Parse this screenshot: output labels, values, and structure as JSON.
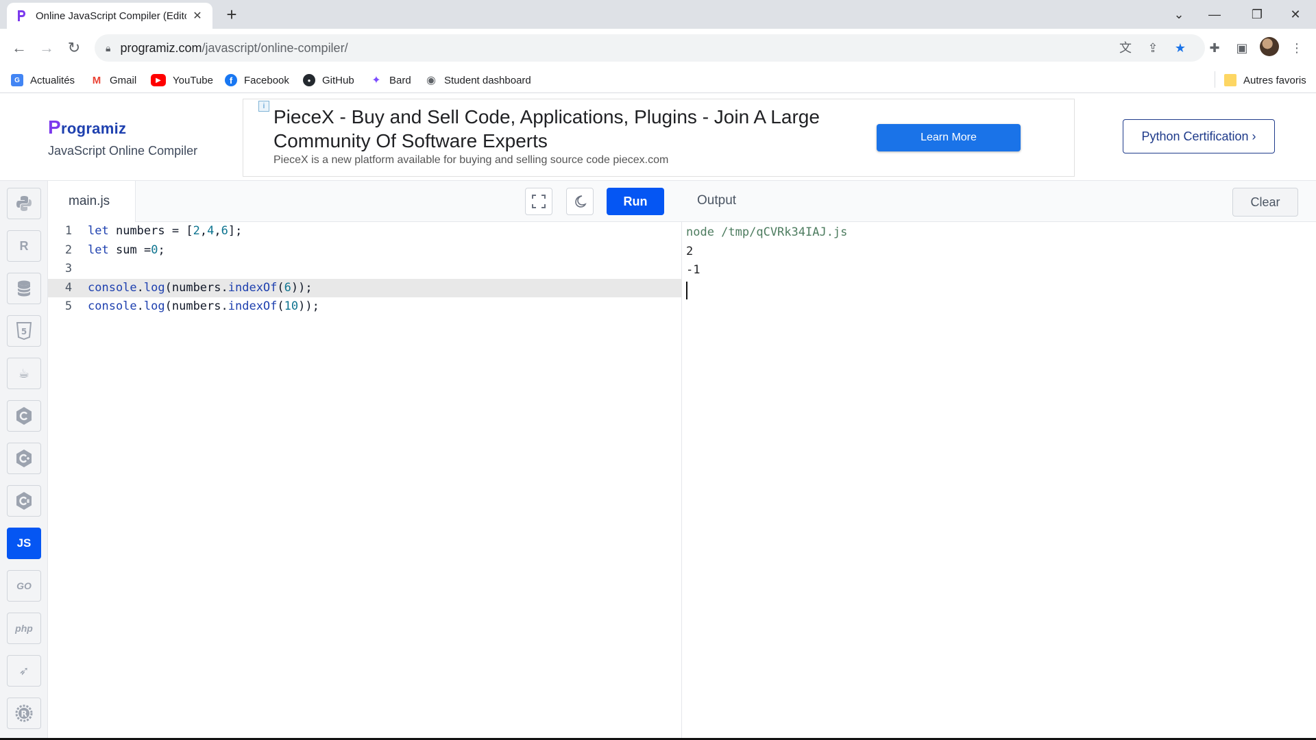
{
  "browser": {
    "tab_title": "Online JavaScript Compiler (Edito",
    "tab_close": "✕",
    "new_tab": "+",
    "url_domain": "programiz.com",
    "url_path": "/javascript/online-compiler/",
    "window_controls": {
      "dropdown": "⌄",
      "minimize": "—",
      "restore": "❐",
      "close": "✕"
    }
  },
  "bookmarks": [
    {
      "label": "Actualités",
      "icon": "news-icon",
      "color": "#4285f4",
      "glyph": "G"
    },
    {
      "label": "Gmail",
      "icon": "gmail-icon",
      "color": "#ea4335",
      "glyph": "M"
    },
    {
      "label": "YouTube",
      "icon": "youtube-icon",
      "color": "#ff0000",
      "glyph": "▶"
    },
    {
      "label": "Facebook",
      "icon": "facebook-icon",
      "color": "#1877f2",
      "glyph": "f"
    },
    {
      "label": "GitHub",
      "icon": "github-icon",
      "color": "#24292f",
      "glyph": "●"
    },
    {
      "label": "Bard",
      "icon": "bard-icon",
      "color": "#7c4dff",
      "glyph": "✦"
    },
    {
      "label": "Student dashboard",
      "icon": "globe-icon",
      "color": "#5f6368",
      "glyph": "◉"
    }
  ],
  "bookmarks_other": "Autres favoris",
  "header": {
    "logo_text": "rogramiz",
    "logo_p": "P",
    "subtitle": "JavaScript Online Compiler",
    "ad": {
      "info": "i",
      "headline": "PieceX - Buy and Sell Code, Applications, Plugins - Join A Large Community Of Software Experts",
      "description": "PieceX is a new platform available for buying and selling source code piecex.com",
      "cta": "Learn More"
    },
    "certification_button": "Python Certification ›"
  },
  "languages": [
    {
      "name": "python-icon",
      "glyph": "🐍",
      "active": false
    },
    {
      "name": "r-lang-icon",
      "glyph": "R",
      "active": false
    },
    {
      "name": "sql-database-icon",
      "glyph": "▤",
      "active": false
    },
    {
      "name": "html5-icon",
      "glyph": "5",
      "active": false
    },
    {
      "name": "java-icon",
      "glyph": "☕",
      "active": false
    },
    {
      "name": "c-lang-icon",
      "glyph": "C",
      "active": false
    },
    {
      "name": "cpp-icon",
      "glyph": "C",
      "active": false
    },
    {
      "name": "csharp-icon",
      "glyph": "C",
      "active": false
    },
    {
      "name": "javascript-icon",
      "glyph": "JS",
      "active": true
    },
    {
      "name": "go-icon",
      "glyph": "GO",
      "active": false
    },
    {
      "name": "php-icon",
      "glyph": "php",
      "active": false
    },
    {
      "name": "swift-icon",
      "glyph": "➶",
      "active": false
    },
    {
      "name": "rust-icon",
      "glyph": "R",
      "active": false
    }
  ],
  "editor": {
    "filename": "main.js",
    "run_label": "Run",
    "lines": [
      {
        "n": "1",
        "text": "let numbers = [2,4,6];"
      },
      {
        "n": "2",
        "text": "let sum =0;"
      },
      {
        "n": "3",
        "text": ""
      },
      {
        "n": "4",
        "text": "console.log(numbers.indexOf(6));",
        "highlight": true
      },
      {
        "n": "5",
        "text": "console.log(numbers.indexOf(10));"
      }
    ]
  },
  "output": {
    "title": "Output",
    "clear_label": "Clear",
    "lines": [
      "node /tmp/qCVRk34IAJ.js",
      "2",
      "-1"
    ]
  }
}
